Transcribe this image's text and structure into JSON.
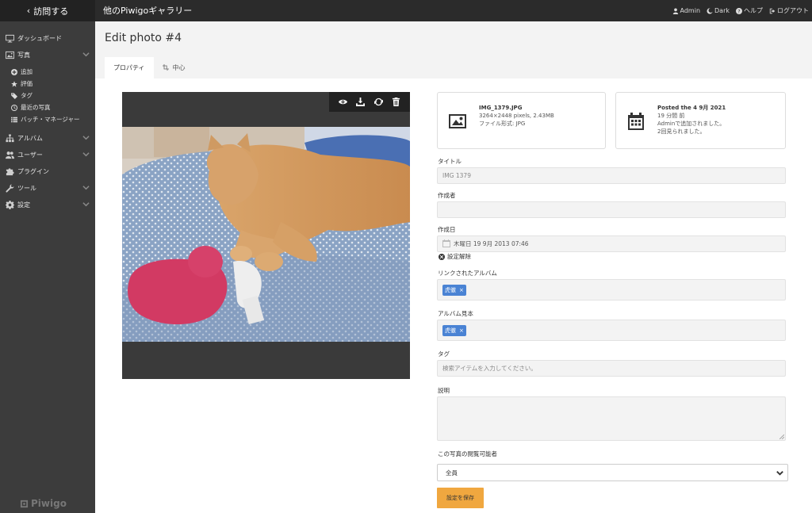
{
  "topbar": {
    "visit_label": "訪問する",
    "gallery_title": "他のPiwigoギャラリー",
    "user_label": "Admin",
    "theme_label": "Dark",
    "help_label": "ヘルプ",
    "logout_label": "ログアウト"
  },
  "sidebar": {
    "dashboard": "ダッシュボード",
    "photos": "写真",
    "photos_sub": [
      "追加",
      "評価",
      "タグ",
      "最近の写真",
      "バッチ・マネージャー"
    ],
    "albums": "アルバム",
    "users": "ユーザー",
    "plugins": "プラグイン",
    "tools": "ツール",
    "settings": "設定",
    "logo": "Piwigo"
  },
  "page": {
    "title": "Edit photo #4",
    "tabs": [
      "プロパティ",
      "中心"
    ]
  },
  "file_card": {
    "filename": "IMG_1379.JPG",
    "dimensions": "3264×2448 pixels, 2.43MB",
    "format": "ファイル形式: JPG"
  },
  "post_card": {
    "posted": "Posted the 4 9月 2021",
    "ago": "19 分間 前",
    "added_by": "Adminで追加されました。",
    "views": "2回見られました。"
  },
  "form": {
    "title_label": "タイトル",
    "title_value": "IMG 1379",
    "author_label": "作成者",
    "author_value": "",
    "date_label": "作成日",
    "date_value": "木曜日 19 9月 2013 07:46",
    "unset_label": "設定解除",
    "linked_albums_label": "リンクされたアルバム",
    "linked_album_tag": "虎徹",
    "representative_label": "アルバム見本",
    "representative_tag": "虎徹",
    "tags_label": "タグ",
    "tags_placeholder": "検索アイテムを入力してください。",
    "description_label": "説明",
    "privacy_label": "この写真の閲覧可能者",
    "privacy_value": "全員",
    "save_label": "設定を保存"
  },
  "colors": {
    "topbar": "#2b2b2b",
    "sidebar": "#3c3c3c",
    "tag_chip": "#4a83d4",
    "save_button": "#f0a73f"
  }
}
